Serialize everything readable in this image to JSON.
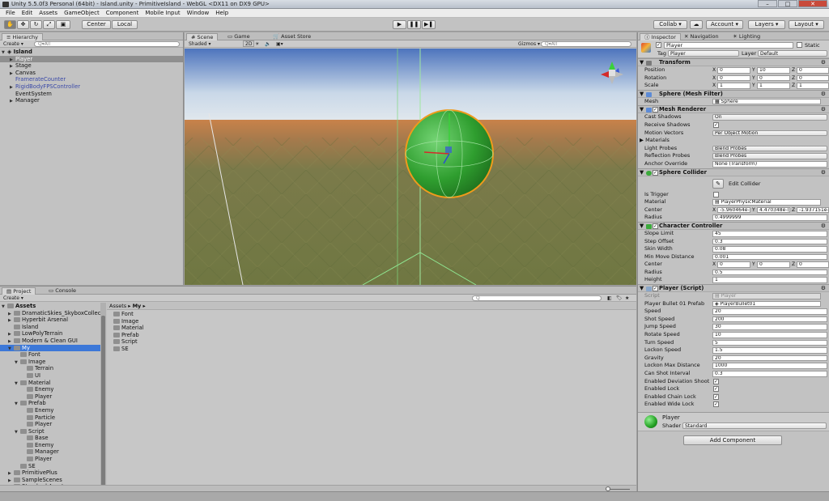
{
  "window": {
    "title": "Unity 5.5.0f3 Personal (64bit) - Island.unity - PrimitiveIsland - WebGL <DX11 on DX9 GPU>"
  },
  "menu": [
    "File",
    "Edit",
    "Assets",
    "GameObject",
    "Component",
    "Mobile Input",
    "Window",
    "Help"
  ],
  "toolbar": {
    "pivot": "Center",
    "space": "Local",
    "collab": "Collab ▾",
    "account": "Account ▾",
    "layers": "Layers ▾",
    "layout": "Layout ▾"
  },
  "hierarchy": {
    "tab": "Hierarchy",
    "create": "Create ▾",
    "search": "Q▾All",
    "scene": "Island",
    "items": [
      {
        "label": "Player",
        "selected": true,
        "expand": true,
        "color": "normal"
      },
      {
        "label": "Stage",
        "expand": true,
        "color": "normal"
      },
      {
        "label": "Canvas",
        "expand": true,
        "color": "normal"
      },
      {
        "label": "FramerateCounter",
        "expand": false,
        "color": "blue"
      },
      {
        "label": "RigidBodyFPSController",
        "expand": true,
        "color": "blue"
      },
      {
        "label": "EventSystem",
        "expand": false,
        "color": "normal"
      },
      {
        "label": "Manager",
        "expand": true,
        "color": "normal"
      }
    ]
  },
  "scene": {
    "tabs": [
      "Scene",
      "Game",
      "Asset Store"
    ],
    "shading": "Shaded",
    "mode2d": "2D",
    "gizmos": "Gizmos ▾",
    "search": "Q▾All"
  },
  "project": {
    "tabs": [
      "Project",
      "Console"
    ],
    "create": "Create ▾",
    "root": "Assets",
    "tree": [
      {
        "label": "DramaticSkies_SkyboxCollection",
        "depth": 1,
        "expand": true
      },
      {
        "label": "Hyperbit Arsenal",
        "depth": 1,
        "expand": true
      },
      {
        "label": "Island",
        "depth": 1,
        "expand": false
      },
      {
        "label": "LowPolyTerrain",
        "depth": 1,
        "expand": true
      },
      {
        "label": "Modern & Clean GUI",
        "depth": 1,
        "expand": true
      },
      {
        "label": "My",
        "depth": 1,
        "expand": true,
        "open": true,
        "selected": true
      },
      {
        "label": "Font",
        "depth": 2
      },
      {
        "label": "Image",
        "depth": 2,
        "expand": true,
        "open": true
      },
      {
        "label": "Terrain",
        "depth": 3
      },
      {
        "label": "UI",
        "depth": 3
      },
      {
        "label": "Material",
        "depth": 2,
        "expand": true,
        "open": true
      },
      {
        "label": "Enemy",
        "depth": 3
      },
      {
        "label": "Player",
        "depth": 3
      },
      {
        "label": "Prefab",
        "depth": 2,
        "expand": true,
        "open": true
      },
      {
        "label": "Enemy",
        "depth": 3
      },
      {
        "label": "Particle",
        "depth": 3
      },
      {
        "label": "Player",
        "depth": 3
      },
      {
        "label": "Script",
        "depth": 2,
        "expand": true,
        "open": true
      },
      {
        "label": "Base",
        "depth": 3
      },
      {
        "label": "Enemy",
        "depth": 3
      },
      {
        "label": "Manager",
        "depth": 3
      },
      {
        "label": "Player",
        "depth": 3
      },
      {
        "label": "SE",
        "depth": 2
      },
      {
        "label": "PrimitivePlus",
        "depth": 1,
        "expand": true
      },
      {
        "label": "SampleScenes",
        "depth": 1,
        "expand": true
      },
      {
        "label": "Standard Assets",
        "depth": 1,
        "expand": true
      }
    ],
    "breadcrumb": [
      "Assets ▸",
      "My ▸"
    ],
    "folders": [
      "Font",
      "Image",
      "Material",
      "Prefab",
      "Script",
      "SE"
    ]
  },
  "inspector": {
    "tabs": [
      "Inspector",
      "Navigation",
      "Lighting"
    ],
    "object": {
      "name": "Player",
      "static": "Static",
      "tag_label": "Tag",
      "tag": "Player",
      "layer_label": "Layer",
      "layer": "Default"
    },
    "transform": {
      "title": "Transform",
      "rows": [
        {
          "label": "Position",
          "x": "0",
          "y": "10",
          "z": "0"
        },
        {
          "label": "Rotation",
          "x": "0",
          "y": "0",
          "z": "0"
        },
        {
          "label": "Scale",
          "x": "1",
          "y": "1",
          "z": "1"
        }
      ]
    },
    "mesh_filter": {
      "title": "Sphere (Mesh Filter)",
      "mesh_label": "Mesh",
      "mesh": "Sphere"
    },
    "mesh_renderer": {
      "title": "Mesh Renderer",
      "cast_shadows_label": "Cast Shadows",
      "cast_shadows": "On",
      "receive_shadows_label": "Receive Shadows",
      "motion_vectors_label": "Motion Vectors",
      "motion_vectors": "Per Object Motion",
      "materials_label": "Materials",
      "light_probes_label": "Light Probes",
      "light_probes": "Blend Probes",
      "reflection_probes_label": "Reflection Probes",
      "reflection_probes": "Blend Probes",
      "anchor_label": "Anchor Override",
      "anchor": "None (Transform)"
    },
    "sphere_collider": {
      "title": "Sphere Collider",
      "edit": "Edit Collider",
      "is_trigger_label": "Is Trigger",
      "material_label": "Material",
      "material": "PlayerPhysicMaterial",
      "center_label": "Center",
      "cx": "-5.960464e-",
      "cy": "4.470348e-(",
      "cz": "-1.937151e-",
      "radius_label": "Radius",
      "radius": "0.4999999"
    },
    "character_controller": {
      "title": "Character Controller",
      "rows": [
        {
          "label": "Slope Limit",
          "value": "45"
        },
        {
          "label": "Step Offset",
          "value": "0.3"
        },
        {
          "label": "Skin Width",
          "value": "0.08"
        },
        {
          "label": "Min Move Distance",
          "value": "0.001"
        }
      ],
      "center_label": "Center",
      "cx": "0",
      "cy": "0",
      "cz": "0",
      "radius_label": "Radius",
      "radius": "0.5",
      "height_label": "Height",
      "height": "1"
    },
    "player_script": {
      "title": "Player (Script)",
      "script_label": "Script",
      "script": "Player",
      "bullet_label": "Player Bullet 01 Prefab",
      "bullet": "PlayerBullet01",
      "rows": [
        {
          "label": "Speed",
          "value": "20"
        },
        {
          "label": "Shot Speed",
          "value": "200"
        },
        {
          "label": "Jump Speed",
          "value": "30"
        },
        {
          "label": "Rotate Speed",
          "value": "10"
        },
        {
          "label": "Turn Speed",
          "value": "5"
        },
        {
          "label": "Lockon Speed",
          "value": "1.5"
        },
        {
          "label": "Gravity",
          "value": "20"
        },
        {
          "label": "Lockon Max Distance",
          "value": "1000"
        },
        {
          "label": "Can Shot Interval",
          "value": "0.3"
        }
      ],
      "checks": [
        "Enabled Deviation Shoot",
        "Enabled Lock",
        "Enabled Chain Lock",
        "Enabled Wide Lock"
      ]
    },
    "material": {
      "name": "Player",
      "shader_label": "Shader",
      "shader": "Standard"
    },
    "add_component": "Add Component"
  },
  "xyz_labels": [
    "X",
    "Y",
    "Z"
  ]
}
